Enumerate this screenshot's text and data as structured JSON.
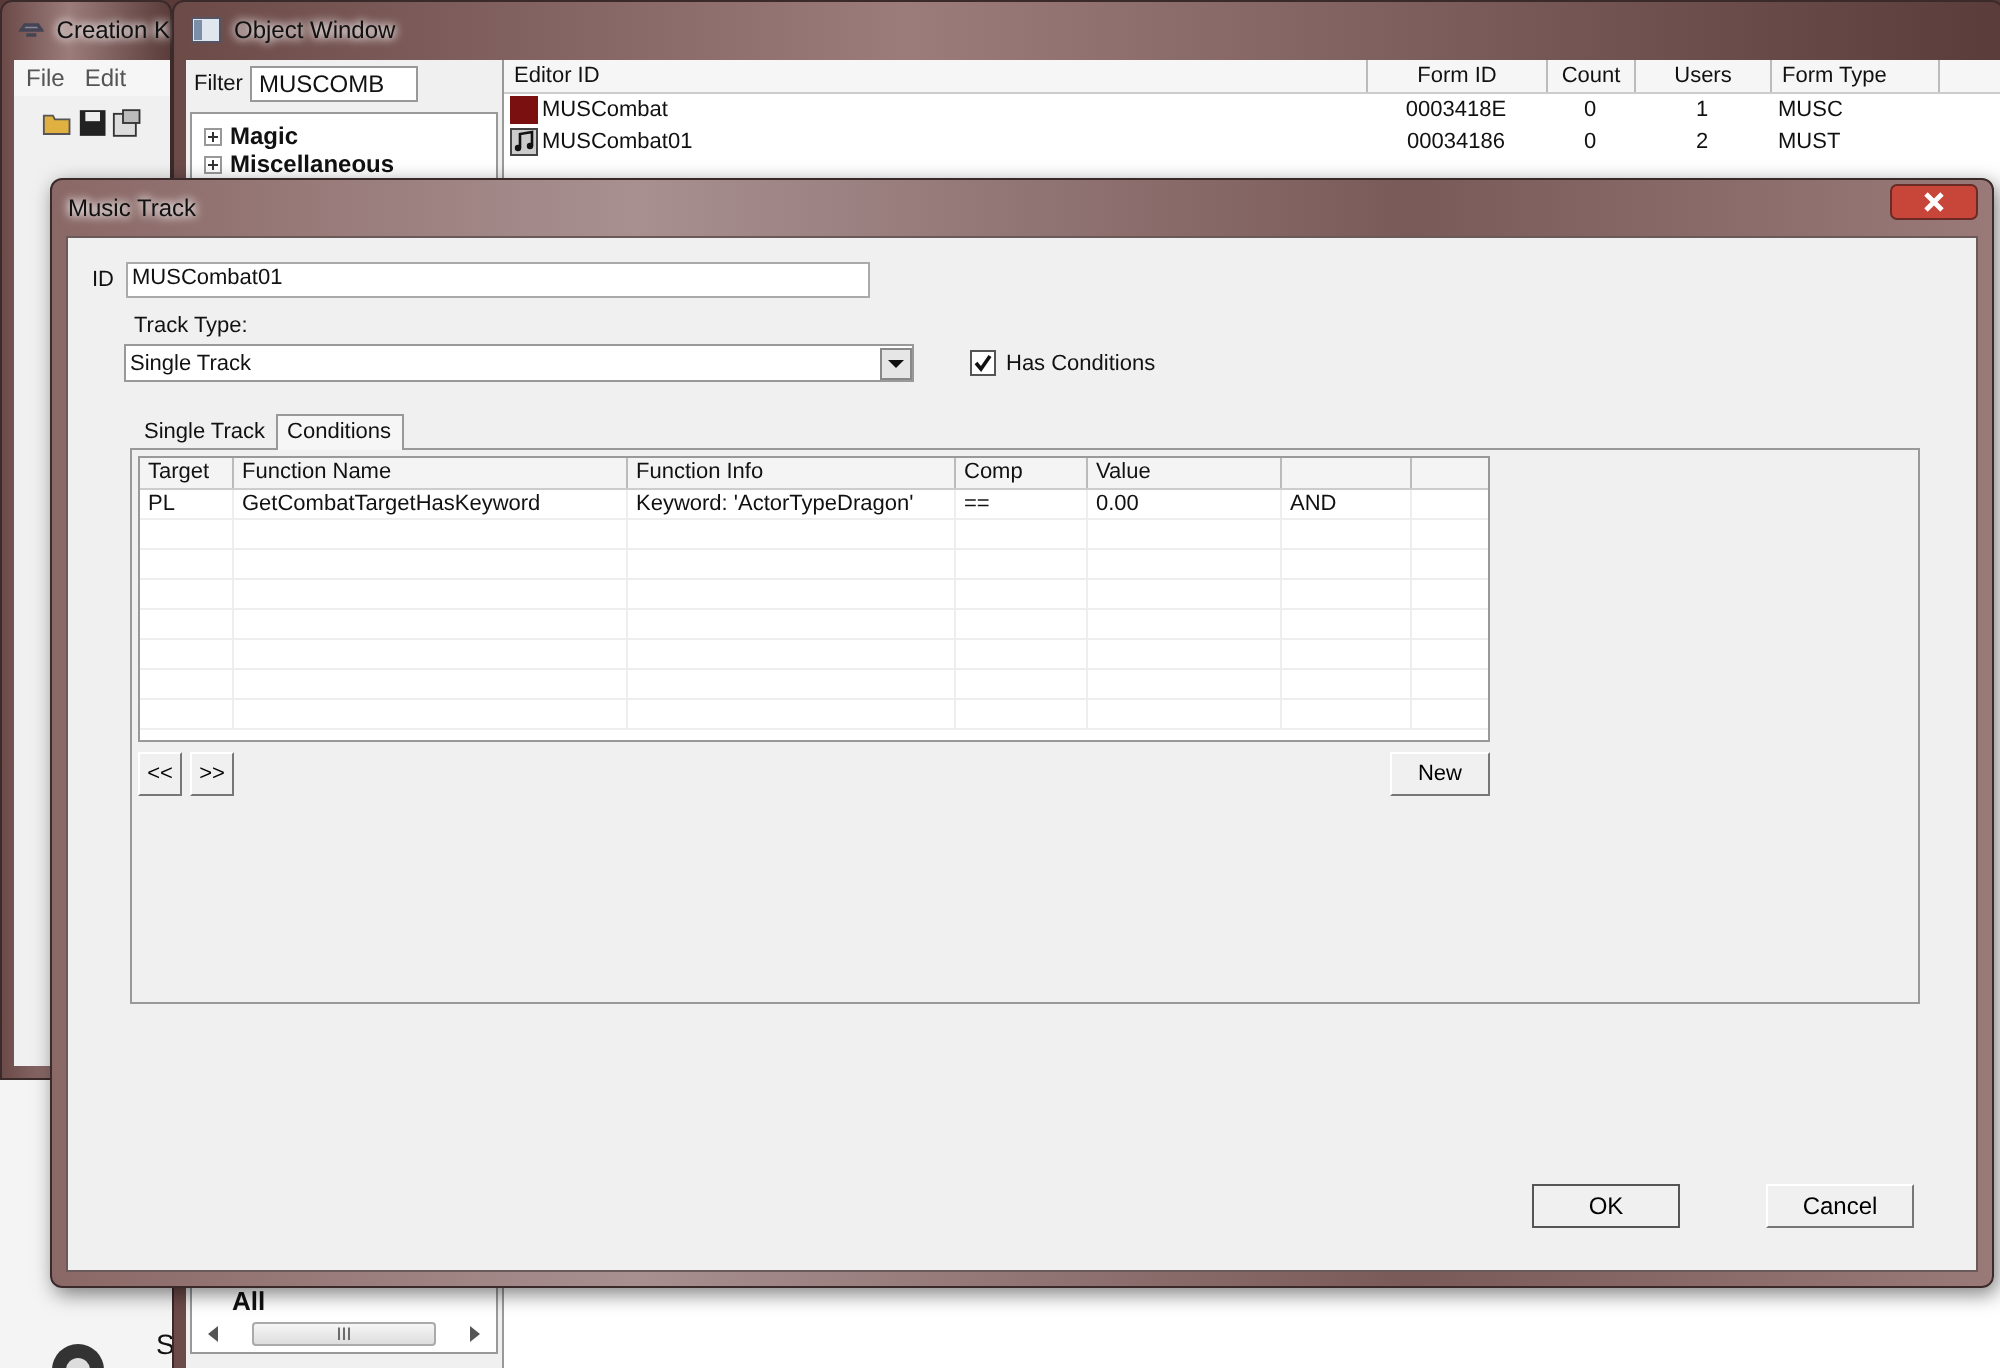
{
  "creation_kit": {
    "title": "Creation K",
    "menu": [
      "File",
      "Edit"
    ]
  },
  "object_window": {
    "title": "Object Window",
    "filter": {
      "label": "Filter",
      "value": "MUSCOMB"
    },
    "tree": [
      {
        "label": "Magic",
        "expanded": false
      },
      {
        "label": "Miscellaneous",
        "expanded": false
      }
    ],
    "category_combo": "All",
    "scroll_grip": "III",
    "columns": [
      "Editor ID",
      "Form ID",
      "Count",
      "Users",
      "Form Type"
    ],
    "rows": [
      {
        "kind": "swatch",
        "cells": [
          "MUSCombat",
          "0003418E",
          "0",
          "1",
          "MUSC"
        ]
      },
      {
        "kind": "note",
        "cells": [
          "MUSCombat01",
          "00034186",
          "0",
          "2",
          "MUST"
        ]
      }
    ]
  },
  "desktop_fragment": "S",
  "dialog": {
    "title": "Music Track",
    "id_label": "ID",
    "id_value": "MUSCombat01",
    "track_type_label": "Track Type:",
    "track_type": "Single Track",
    "has_conditions": {
      "label": "Has Conditions",
      "checked": true
    },
    "tabs": [
      {
        "label": "Single Track",
        "selected": false
      },
      {
        "label": "Conditions",
        "selected": true
      }
    ],
    "grid": {
      "columns": [
        "Target",
        "Function Name",
        "Function Info",
        "Comp",
        "Value"
      ],
      "rows": [
        {
          "cells": [
            "PL",
            "GetCombatTargetHasKeyword",
            "Keyword: 'ActorTypeDragon'",
            "==",
            "0.00",
            "AND"
          ]
        }
      ]
    },
    "nav_buttons": [
      "<<",
      ">>"
    ],
    "new_button": "New",
    "ok_button": "OK",
    "cancel_button": "Cancel"
  }
}
